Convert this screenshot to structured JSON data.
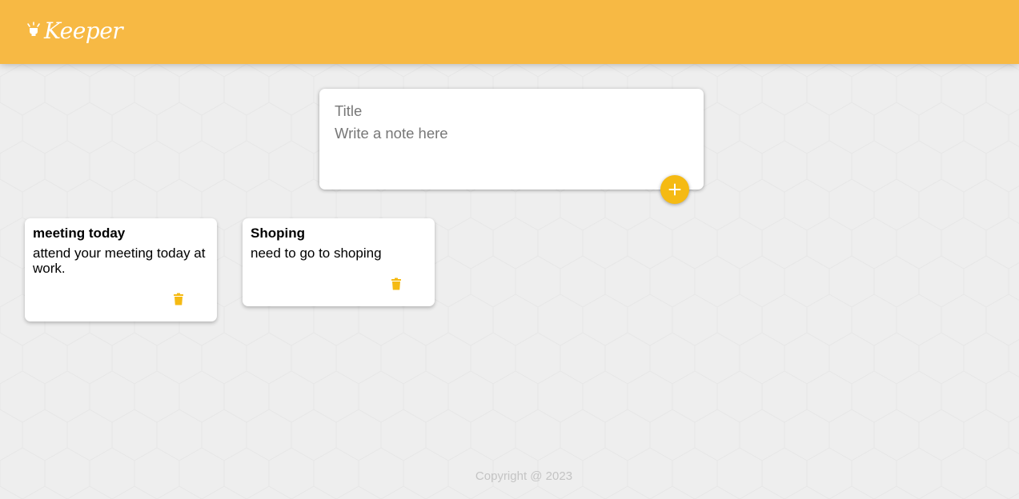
{
  "header": {
    "title": "Keeper",
    "logo_icon": "lightbulb-icon",
    "background_color": "#f7b944"
  },
  "create_area": {
    "title_placeholder": "Title",
    "content_placeholder": "Write a note here",
    "add_icon": "plus-icon",
    "accent_color": "#f5ba13"
  },
  "notes": [
    {
      "title": "meeting today",
      "content": "attend your meeting today at work.",
      "delete_icon": "trash-icon"
    },
    {
      "title": "Shoping",
      "content": "need to go to shoping",
      "delete_icon": "trash-icon"
    }
  ],
  "footer": {
    "text": "Copyright @ 2023"
  }
}
